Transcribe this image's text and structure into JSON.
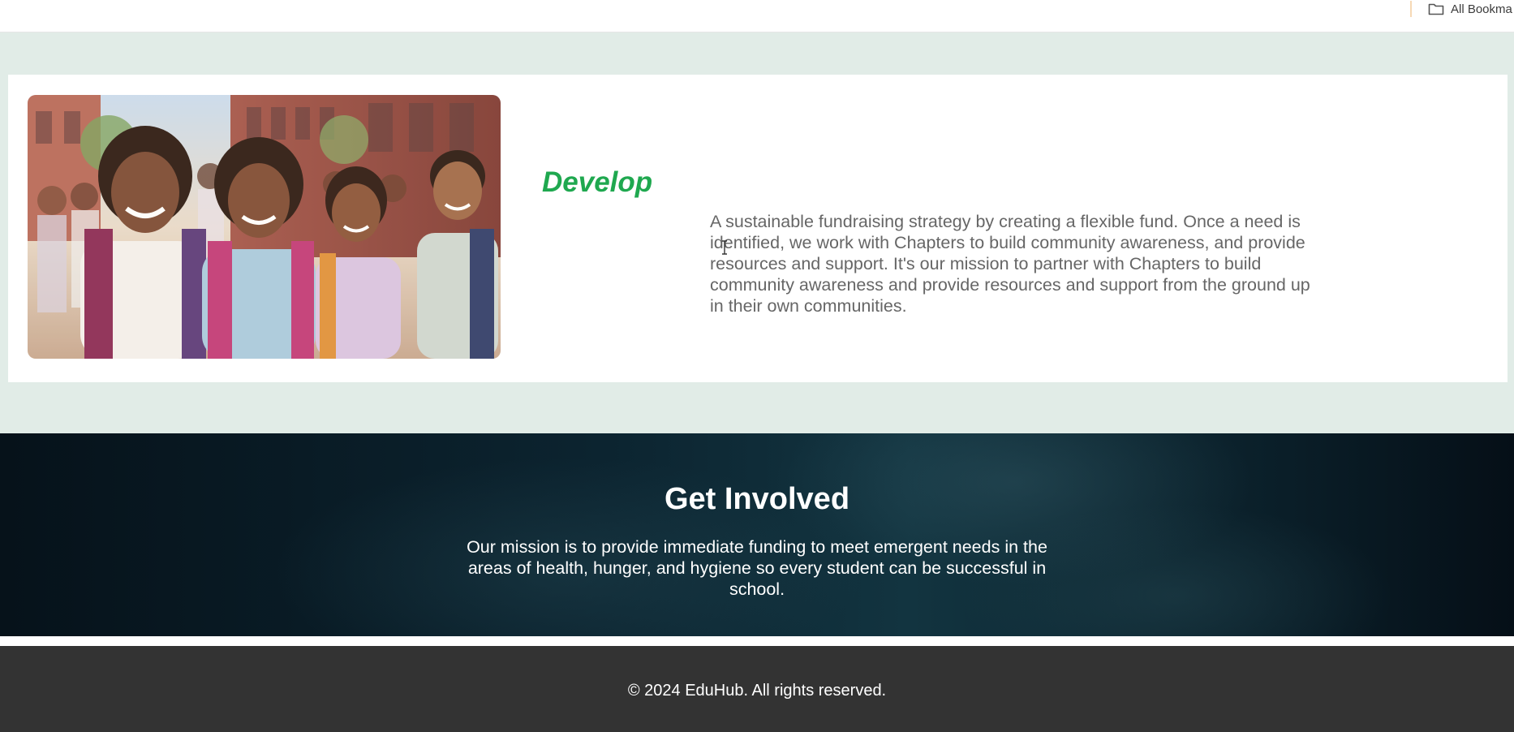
{
  "bookmarks_bar": {
    "folder_label": "All Bookma",
    "folder_icon": "folder-icon"
  },
  "feature": {
    "heading": "Develop",
    "text": "A sustainable fundraising strategy by creating a flexible fund. Once a need is identified, we work with Chapters to build community awareness, and provide resources and support. It's our mission to partner with Chapters to build community awareness and provide resources and support from the ground up in their own communities.",
    "heading_color": "#1fa84f",
    "image_alt": "Smiling students with backpacks walking to school"
  },
  "get_involved": {
    "title": "Get Involved",
    "text": "Our mission is to provide immediate funding to meet emergent needs in the areas of health, hunger, and hygiene so every student can be successful in school."
  },
  "footer": {
    "copyright": "© 2024 EduHub. All rights reserved."
  },
  "colors": {
    "mint_background": "#e1ece7",
    "footer_background": "#333333",
    "accent_green": "#1fa84f"
  }
}
